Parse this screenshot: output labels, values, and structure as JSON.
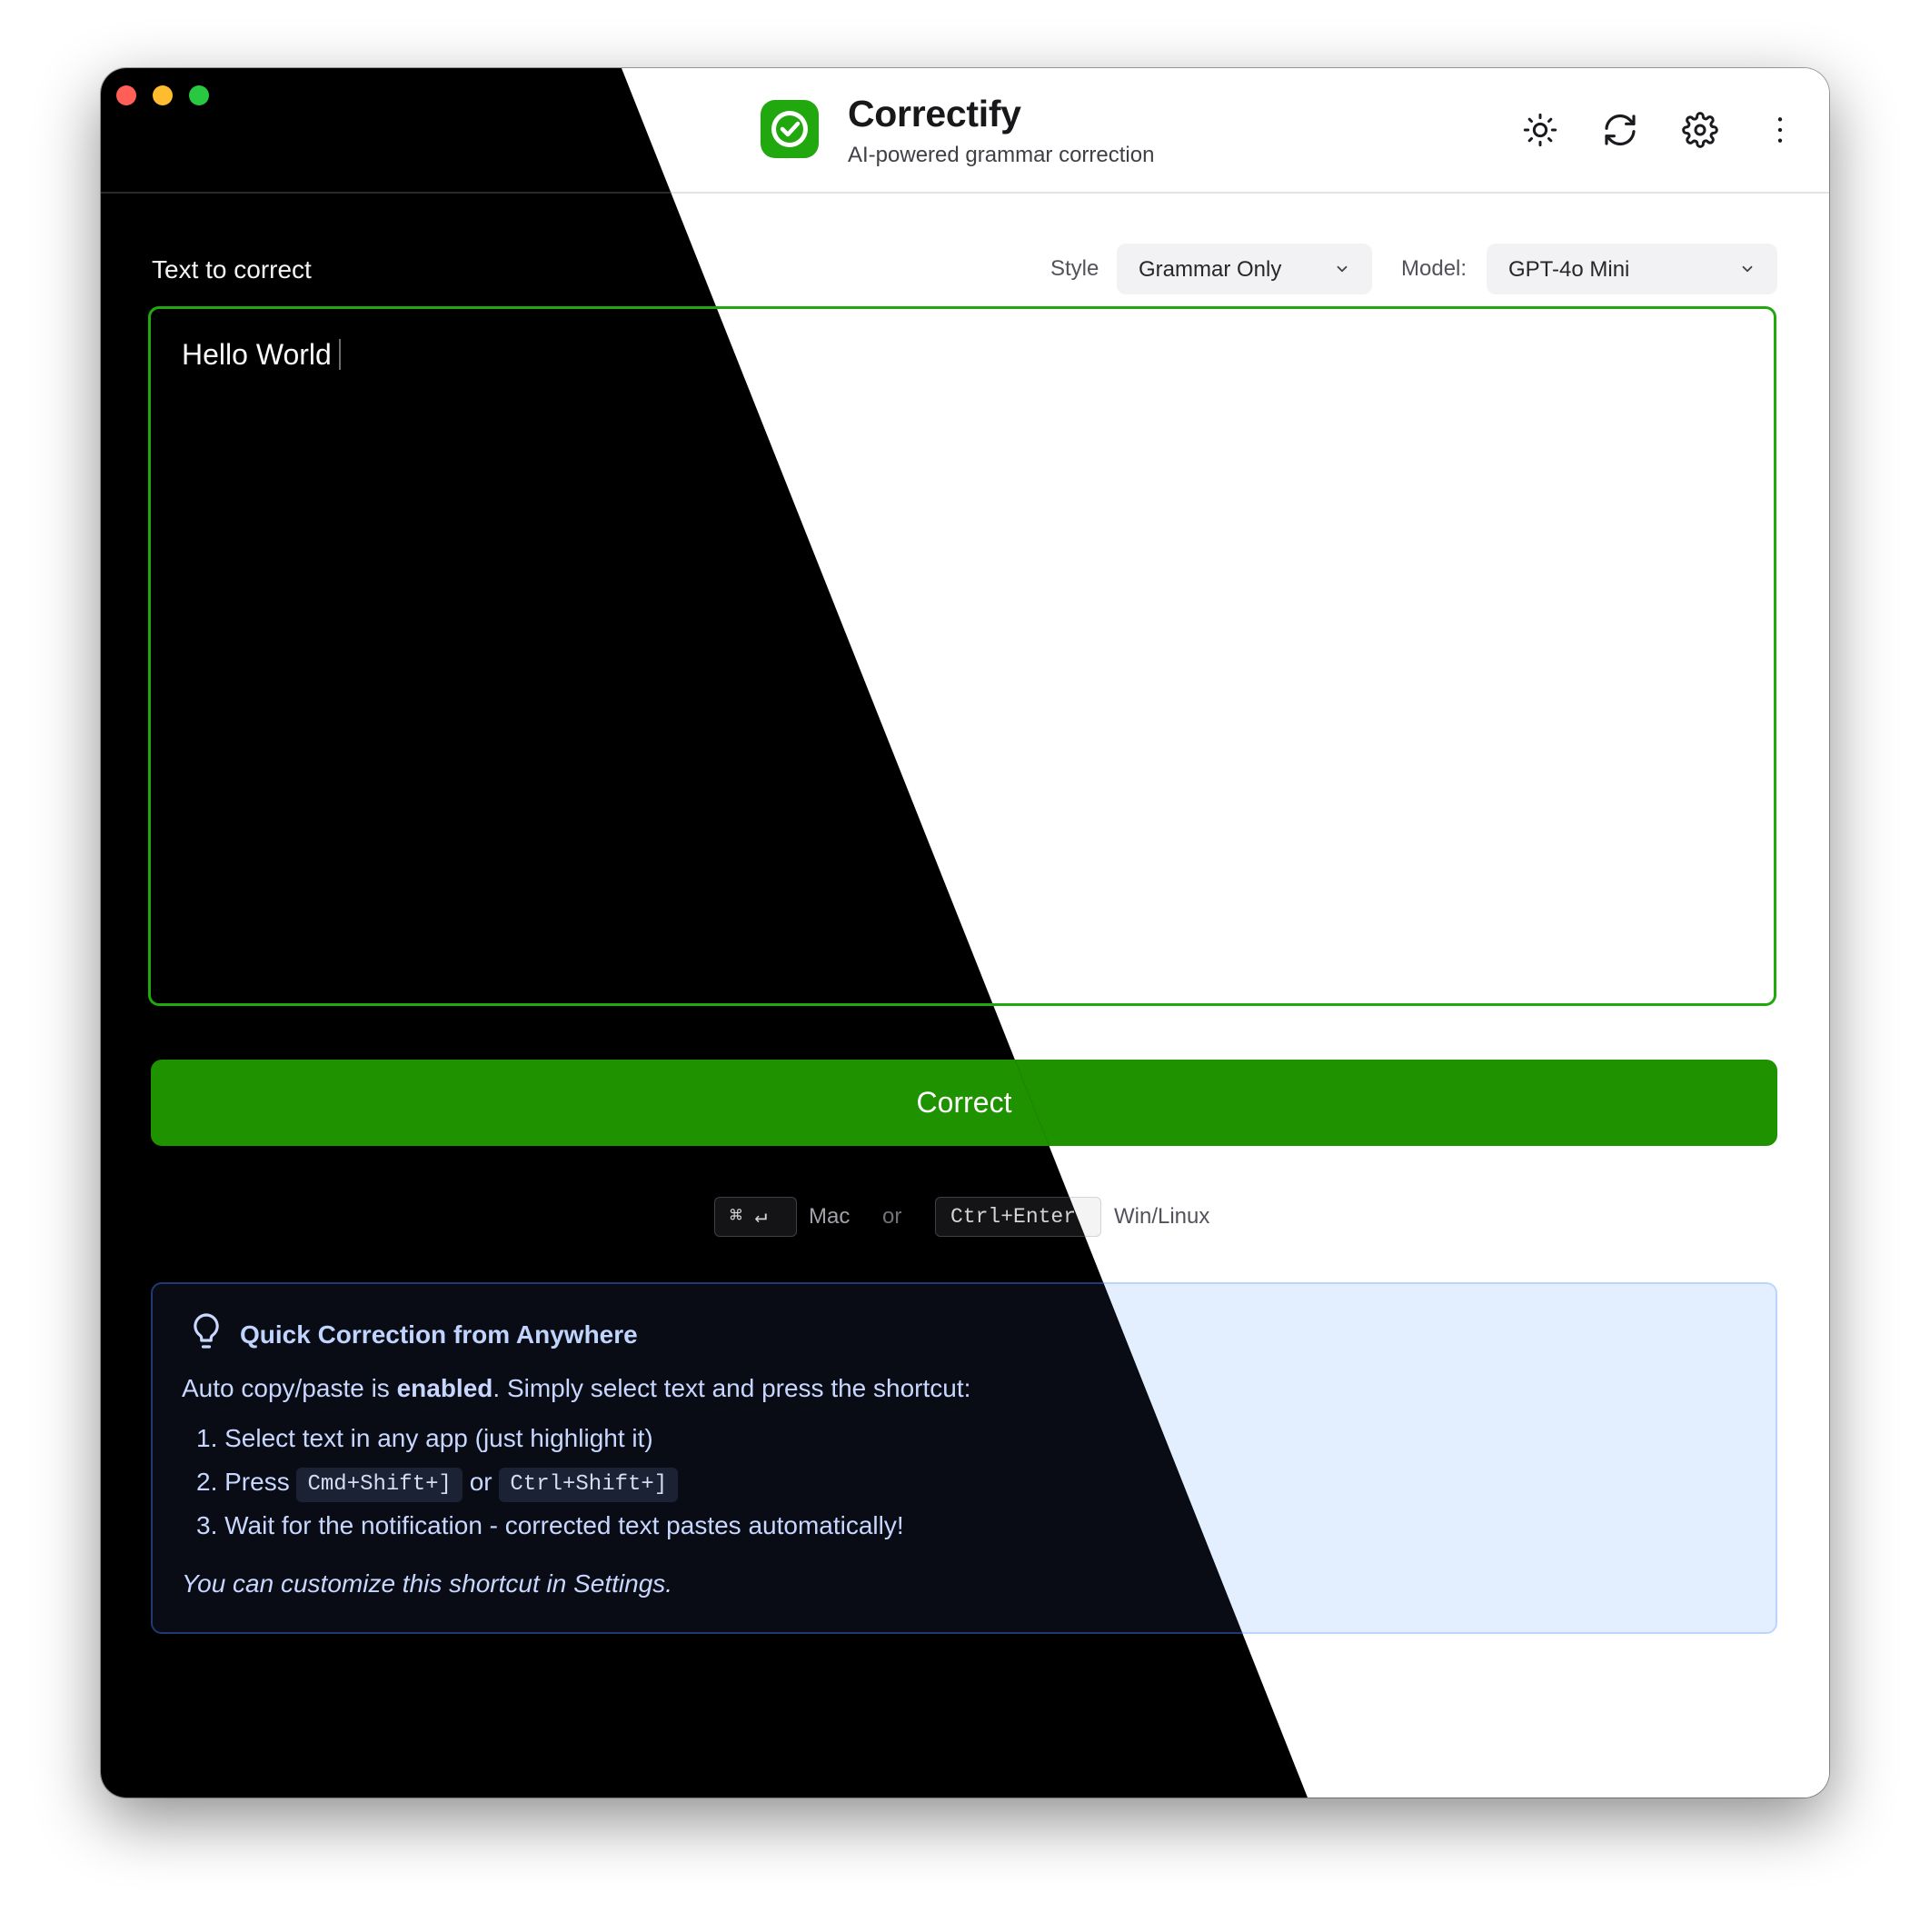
{
  "header": {
    "title": "Correctify",
    "subtitle": "AI-powered grammar correction",
    "actions": [
      "theme-toggle",
      "refresh",
      "settings",
      "more"
    ]
  },
  "input": {
    "label": "Text to correct",
    "value": "Hello World",
    "style_label": "Style",
    "style_value": "Grammar Only",
    "model_label": "Model:",
    "model_value": "GPT-4o Mini"
  },
  "correct_button": "Correct",
  "shortcuts": {
    "mac_key": "⌘ ↵",
    "mac_label": "Mac",
    "or": "or",
    "win_key": "Ctrl+Enter",
    "win_label": "Win/Linux"
  },
  "tip": {
    "title": "Quick Correction from Anywhere",
    "intro_before": "Auto copy/paste is ",
    "intro_bold": "enabled",
    "intro_after": ". Simply select text and press the shortcut:",
    "step1": "1.  Select text in any app (just highlight it)",
    "step2_prefix": "2.  Press ",
    "step2_key1": "Cmd+Shift+]",
    "step2_or": " or ",
    "step2_key2": "Ctrl+Shift+]",
    "step3": "3.  Wait for the notification - corrected text pastes automatically!",
    "note": "You can customize this shortcut in Settings."
  },
  "colors": {
    "accent": "#1f9200",
    "logo": "#22a80f",
    "light_background": "#ffffff",
    "dark_background": "#000000"
  }
}
